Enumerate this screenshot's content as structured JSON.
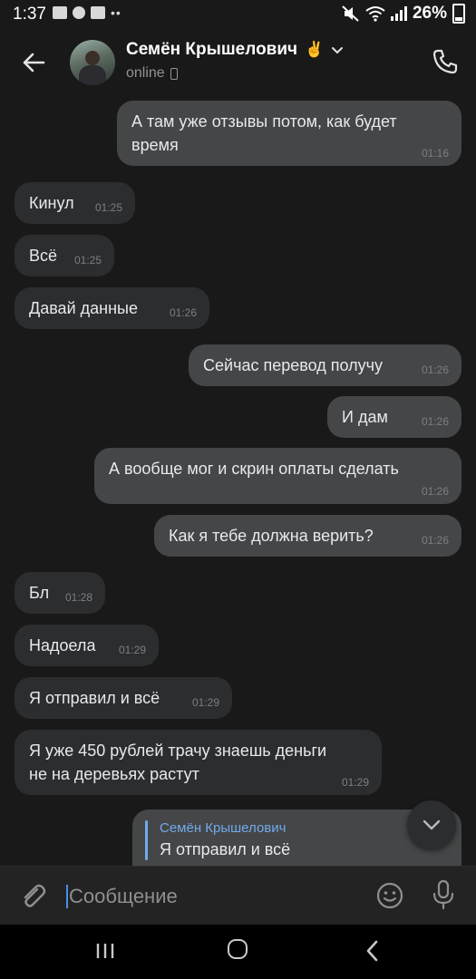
{
  "status_bar": {
    "time": "1:37",
    "battery": "26%"
  },
  "header": {
    "contact_name": "Семён Крышелович",
    "contact_emoji": "✌",
    "presence": "online"
  },
  "messages": [
    {
      "dir": "out",
      "text": "А там уже отзывы потом, как будет\nвремя",
      "time": "01:16"
    },
    {
      "dir": "in",
      "text": "Кинул",
      "time": "01:25"
    },
    {
      "dir": "in",
      "text": "Всё",
      "time": "01:25"
    },
    {
      "dir": "in",
      "text": "Давай данные",
      "time": "01:26"
    },
    {
      "dir": "out",
      "text": "Сейчас перевод получу",
      "time": "01:26"
    },
    {
      "dir": "out",
      "text": "И дам",
      "time": "01:26"
    },
    {
      "dir": "out",
      "text": "А вообще мог и скрин оплаты сделать",
      "time": "01:26"
    },
    {
      "dir": "out",
      "text": "Как я тебе должна верить?",
      "time": "01:26"
    },
    {
      "dir": "in",
      "text": "Бл",
      "time": "01:28"
    },
    {
      "dir": "in",
      "text": "Надоела",
      "time": "01:29"
    },
    {
      "dir": "in",
      "text": "Я отправил и всё",
      "time": "01:29"
    },
    {
      "dir": "in",
      "text": "Я уже 450 рублей трачу знаешь деньги\nне на деревьях растут",
      "time": "01:29"
    }
  ],
  "reply_preview": {
    "author": "Семён Крышелович",
    "text": "Я отправил и всё"
  },
  "composer": {
    "placeholder": "Сообщение"
  },
  "colors": {
    "background": "#19191a",
    "bubble_in": "#2c2d2e",
    "bubble_out": "#454647",
    "accent": "#4a90e2",
    "reply_author": "#71aaeb"
  },
  "icons": [
    "back-arrow-icon",
    "chevron-down-icon",
    "phone-icon",
    "attach-icon",
    "emoji-icon",
    "microphone-icon",
    "scroll-down-icon"
  ]
}
